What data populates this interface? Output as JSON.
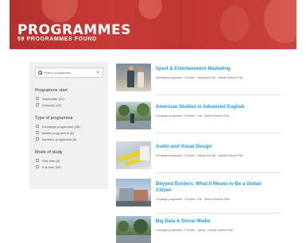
{
  "hero": {
    "title": "PROGRAMMES",
    "count_text": "59  PROGRAMMES FOUND"
  },
  "sidebar": {
    "search": {
      "placeholder": "Search programme",
      "clear_icon": "×"
    },
    "groups": [
      {
        "title": "Programme start",
        "options": [
          "September (31)",
          "February (22)"
        ]
      },
      {
        "title": "Type of programme",
        "options": [
          "Exchange programme (45)",
          "Master programme (8)",
          "Bachelor programme (8)"
        ]
      },
      {
        "title": "Mode of study",
        "options": [
          "Part-time (0)",
          "Full-time (59)"
        ]
      }
    ]
  },
  "programmes": [
    {
      "title": "Sport & Entertainment Marketing",
      "meta": "Exchange programme · Full-time · Spring and Fall · Utrecht Science Park"
    },
    {
      "title": "American Studies in Advanced English",
      "meta": "Exchange programme · Full-time · Fall · Utrecht Science Park"
    },
    {
      "title": "Audio and Visual Design",
      "meta": "Exchange programme · Full-time · Spring and Fall · Utrecht Science Park"
    },
    {
      "title": "Beyond Borders: What It Means to Be a Global Citizen",
      "meta": "Exchange programme · Full-time · Fall · Utrecht Science Park"
    },
    {
      "title": "Big Data & Social Media",
      "meta": "Exchange programme · Full-time · Spring · Utrecht Science Park"
    }
  ],
  "colors": {
    "accent_red": "#d72828",
    "link_blue": "#1b9be0",
    "sidebar_bg": "#f0f0f0"
  }
}
